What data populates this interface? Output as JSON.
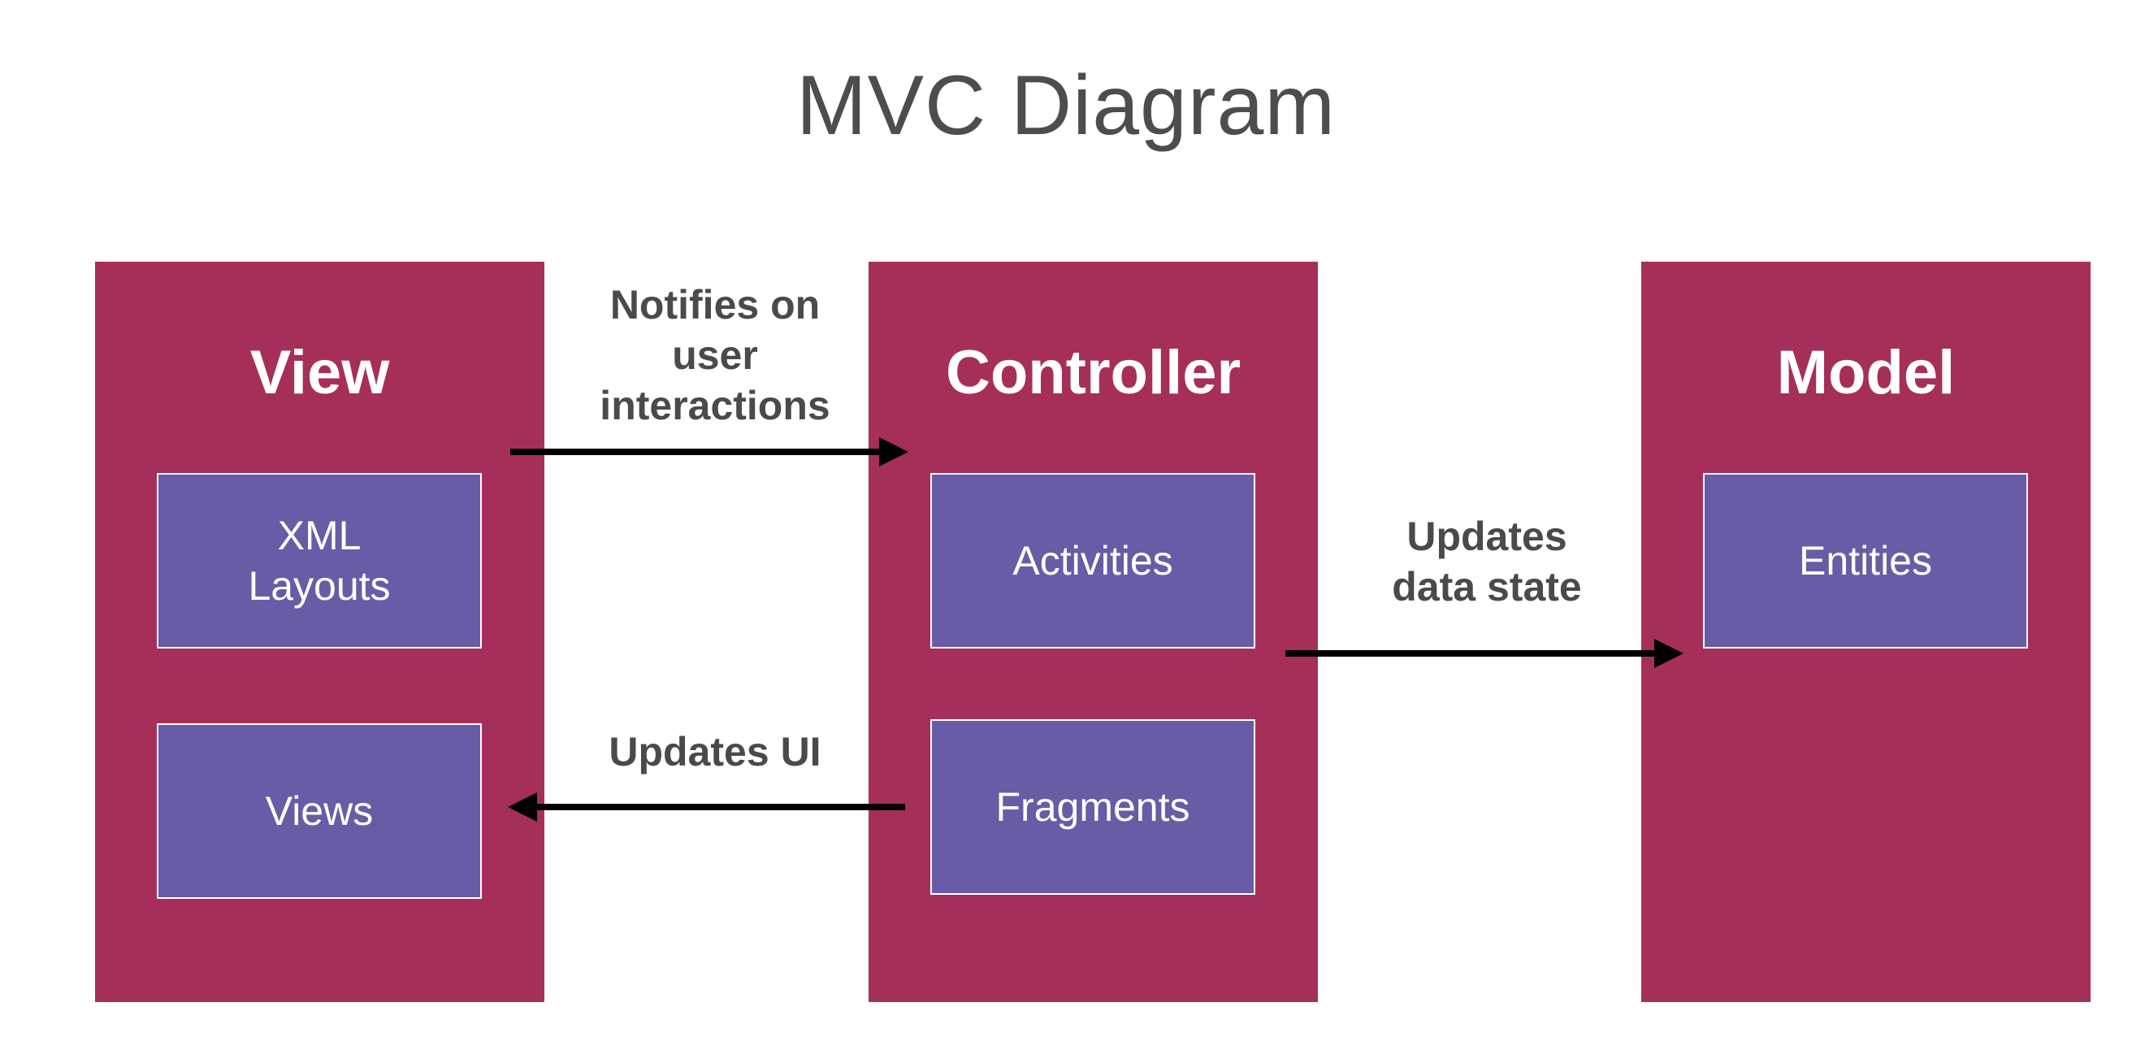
{
  "title": "MVC Diagram",
  "colors": {
    "column_fill": "#A62F5A",
    "inner_fill": "#685CA6",
    "inner_border": "#FFFFFF",
    "label_text": "#4A4A4A",
    "arrow": "#000000"
  },
  "columns": {
    "view": {
      "title": "View",
      "items": [
        "XML\nLayouts",
        "Views"
      ]
    },
    "controller": {
      "title": "Controller",
      "items": [
        "Activities",
        "Fragments"
      ]
    },
    "model": {
      "title": "Model",
      "items": [
        "Entities"
      ]
    }
  },
  "edges": [
    {
      "from": "View",
      "to": "Controller",
      "label": "Notifies on\nuser\ninteractions"
    },
    {
      "from": "Controller",
      "to": "Model",
      "label": "Updates\ndata state"
    },
    {
      "from": "Controller",
      "to": "View",
      "label": "Updates UI"
    }
  ],
  "edge_labels": {
    "notify": "Notifies on\nuser\ninteractions",
    "updates_data": "Updates\ndata state",
    "updates_ui": "Updates UI"
  }
}
